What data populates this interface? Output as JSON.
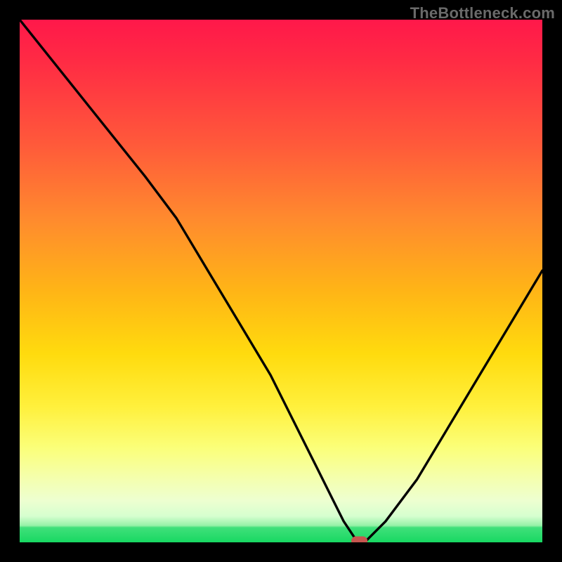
{
  "watermark": "TheBottleneck.com",
  "chart_data": {
    "type": "line",
    "title": "",
    "xlabel": "",
    "ylabel": "",
    "xlim": [
      0,
      100
    ],
    "ylim": [
      0,
      100
    ],
    "grid": false,
    "series": [
      {
        "name": "bottleneck-curve",
        "x": [
          0,
          8,
          16,
          24,
          30,
          36,
          42,
          48,
          53,
          57,
          60,
          62,
          64,
          66,
          70,
          76,
          82,
          88,
          94,
          100
        ],
        "values": [
          100,
          90,
          80,
          70,
          62,
          52,
          42,
          32,
          22,
          14,
          8,
          4,
          1,
          0,
          4,
          12,
          22,
          32,
          42,
          52
        ]
      }
    ],
    "marker": {
      "x": 65,
      "y": 0,
      "shape": "pill",
      "color": "#c7564f"
    },
    "background_gradient": {
      "direction": "top-to-bottom",
      "stops": [
        {
          "pos": 0.0,
          "color": "#ff184a"
        },
        {
          "pos": 0.24,
          "color": "#ff5a3a"
        },
        {
          "pos": 0.52,
          "color": "#ffb516"
        },
        {
          "pos": 0.74,
          "color": "#fff03c"
        },
        {
          "pos": 0.9,
          "color": "#f0ffc0"
        },
        {
          "pos": 0.97,
          "color": "#3fe07a"
        },
        {
          "pos": 1.0,
          "color": "#18d862"
        }
      ]
    }
  }
}
